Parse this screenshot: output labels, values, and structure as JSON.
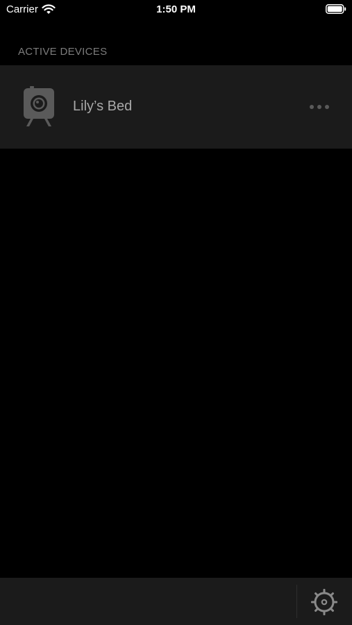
{
  "status_bar": {
    "carrier": "Carrier",
    "time": "1:50 PM",
    "wifi_icon": "wifi-icon",
    "battery_icon": "battery-full-icon"
  },
  "devices": {
    "section_title": "ACTIVE DEVICES",
    "items": [
      {
        "name": "Lily’s Bed",
        "icon": "camera-device-icon",
        "action_icon": "more-options-icon"
      }
    ]
  },
  "bottom_bar": {
    "settings_icon": "gear-icon"
  },
  "colors": {
    "background": "#000000",
    "row_background": "#1b1b1b",
    "section_text": "#7c7c7c",
    "device_text": "#a9a9a9",
    "icon_gray": "#5a5a5a"
  }
}
